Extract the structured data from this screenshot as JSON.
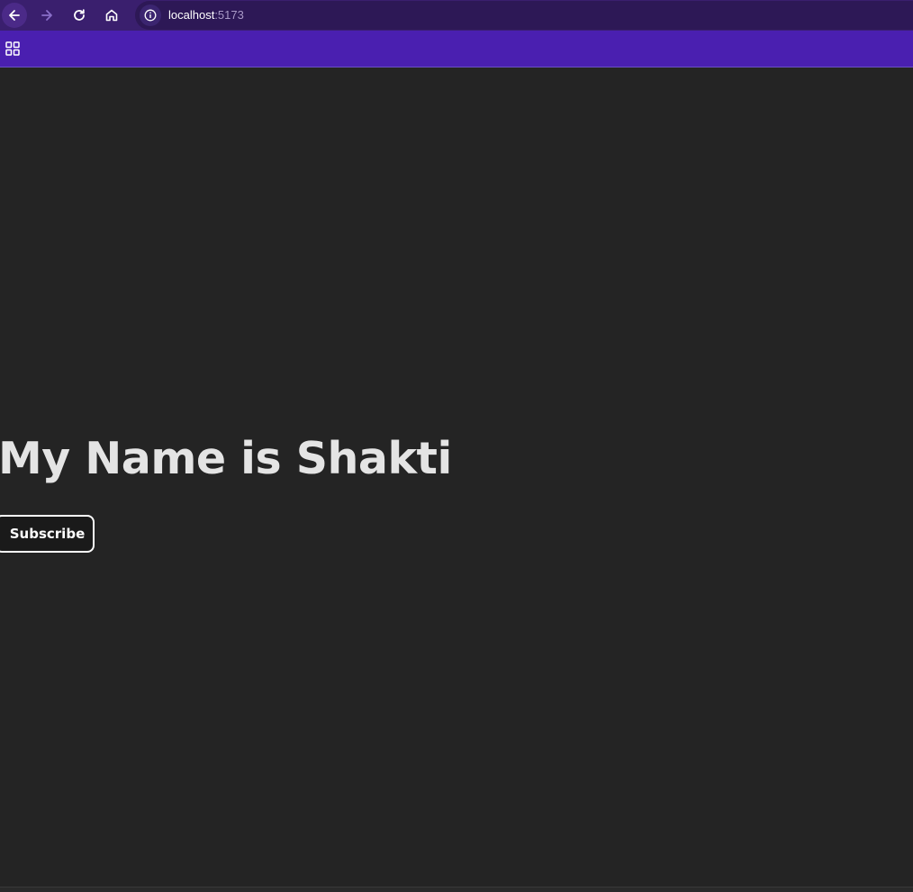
{
  "browser": {
    "url_host": "localhost",
    "url_port": ":5173",
    "icons": {
      "back": "arrow-left-icon",
      "forward": "arrow-right-icon",
      "reload": "reload-icon",
      "home": "home-icon",
      "site_info": "info-icon",
      "apps": "apps-grid-icon"
    },
    "colors": {
      "toolbar": "#3a1f6e",
      "bookmark_bar": "#4a1fb0",
      "page_background": "#242424"
    }
  },
  "page": {
    "heading": "My Name is Shakti",
    "subscribe_label": "Subscribe"
  }
}
